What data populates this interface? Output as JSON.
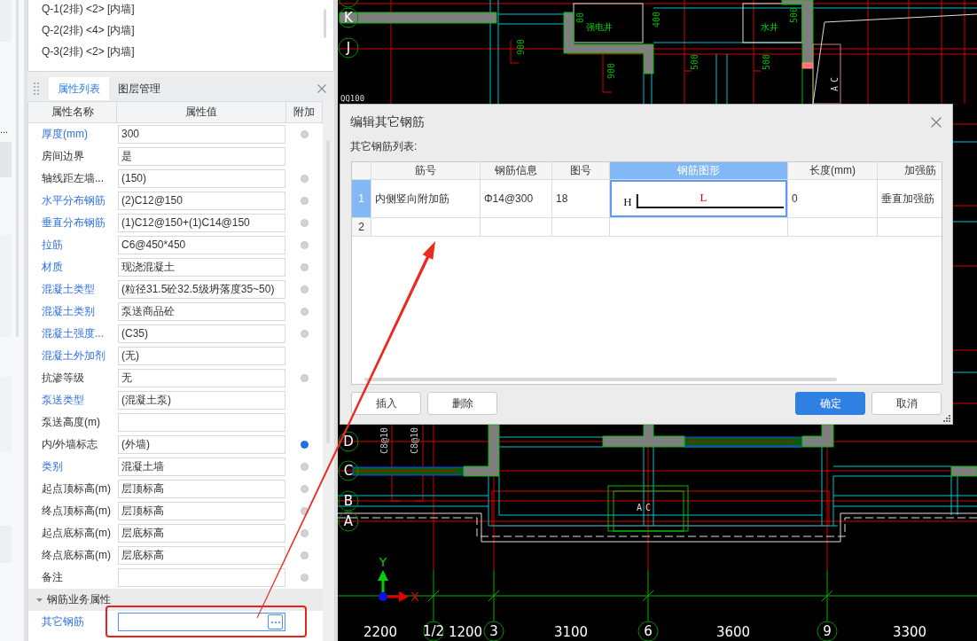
{
  "left_strip": {
    "label": "..."
  },
  "component_list": {
    "items": [
      {
        "label": "Q-1(2排) <2> [内墙]",
        "selected": false
      },
      {
        "label": "Q-2(2排) <4> [内墙]",
        "selected": false
      },
      {
        "label": "Q-3(2排) <2> [内墙]",
        "selected": false
      }
    ]
  },
  "properties_panel": {
    "tabs": [
      {
        "label": "属性列表",
        "selected": true
      },
      {
        "label": "图层管理",
        "selected": false
      }
    ],
    "columns": [
      "属性名称",
      "属性值",
      "附加"
    ],
    "rows": [
      {
        "kind": "property",
        "label": "厚度(mm)",
        "public": true,
        "value": "300",
        "focused": false,
        "checked": false
      },
      {
        "kind": "property",
        "label": "房间边界",
        "public": false,
        "value": "是",
        "focused": false
      },
      {
        "kind": "property",
        "label": "轴线距左墙...",
        "public": false,
        "value": "(150)",
        "focused": false,
        "checked": false
      },
      {
        "kind": "property",
        "label": "水平分布钢筋",
        "public": true,
        "value": "(2)C12@150",
        "focused": false,
        "checked": false
      },
      {
        "kind": "property",
        "label": "垂直分布钢筋",
        "public": true,
        "value": "(1)C12@150+(1)C14@150",
        "focused": false,
        "checked": false
      },
      {
        "kind": "property",
        "label": "拉筋",
        "public": true,
        "value": "C6@450*450",
        "focused": false,
        "checked": false
      },
      {
        "kind": "property",
        "label": "材质",
        "public": true,
        "value": "现浇混凝土",
        "focused": false,
        "checked": false
      },
      {
        "kind": "property",
        "label": "混凝土类型",
        "public": true,
        "value": "(粒径31.5砼32.5级坍落度35~50)",
        "focused": false,
        "checked": false
      },
      {
        "kind": "property",
        "label": "混凝土类别",
        "public": true,
        "value": "泵送商品砼",
        "focused": false,
        "checked": false
      },
      {
        "kind": "property",
        "label": "混凝土强度...",
        "public": true,
        "value": "(C35)",
        "focused": false,
        "checked": false
      },
      {
        "kind": "property",
        "label": "混凝土外加剂",
        "public": true,
        "value": "(无)",
        "focused": false
      },
      {
        "kind": "property",
        "label": "抗渗等级",
        "public": false,
        "value": "无",
        "focused": false,
        "checked": false
      },
      {
        "kind": "property",
        "label": "泵送类型",
        "public": true,
        "value": "(混凝土泵)",
        "focused": false
      },
      {
        "kind": "property",
        "label": "泵送高度(m)",
        "public": false,
        "focused": false
      },
      {
        "kind": "property",
        "label": "内/外墙标志",
        "public": false,
        "value": "(外墙)",
        "focused": false,
        "checked": true
      },
      {
        "kind": "property",
        "label": "类别",
        "public": true,
        "value": "混凝土墙",
        "focused": false,
        "checked": false
      },
      {
        "kind": "property",
        "label": "起点顶标高(m)",
        "public": false,
        "value": "层顶标高",
        "focused": false,
        "checked": false
      },
      {
        "kind": "property",
        "label": "终点顶标高(m)",
        "public": false,
        "value": "层顶标高",
        "focused": false,
        "checked": false
      },
      {
        "kind": "property",
        "label": "起点底标高(m)",
        "public": false,
        "value": "层底标高",
        "focused": false,
        "checked": false
      },
      {
        "kind": "property",
        "label": "终点底标高(m)",
        "public": false,
        "value": "层底标高",
        "focused": false,
        "checked": false
      },
      {
        "kind": "property",
        "label": "备注",
        "public": false,
        "focused": false,
        "checked": false
      },
      {
        "kind": "group",
        "title": "钢筋业务属性",
        "expanded": true
      },
      {
        "kind": "property",
        "label": "其它钢筋",
        "public": true,
        "focused": true
      }
    ]
  },
  "drawing": {
    "row_axes": [
      "K",
      "J",
      "D",
      "C",
      "B",
      "A"
    ],
    "column_axes": [
      "1/2",
      "3",
      "6",
      "9"
    ],
    "spans": [
      "2200",
      "1200",
      "3100",
      "3600",
      "3300"
    ],
    "dimension_marks": [
      "900",
      "00",
      "900",
      "400",
      "500",
      "500",
      "500"
    ],
    "room_labels": [
      "强电井",
      "水井"
    ],
    "rebar_notes": [
      "C8@10",
      "C8@10"
    ],
    "unit_labels": [
      "AC",
      "AC"
    ],
    "wall_tag": "QQ100",
    "axes": {
      "x": "X",
      "y": "Y"
    }
  },
  "dialog": {
    "title": "编辑其它钢筋",
    "list_label": "其它钢筋列表:",
    "columns": [
      {
        "label": "筋号",
        "selected": false
      },
      {
        "label": "钢筋信息",
        "selected": false
      },
      {
        "label": "图号",
        "selected": false
      },
      {
        "label": "钢筋图形",
        "selected": true
      },
      {
        "label": "长度(mm)",
        "selected": false
      },
      {
        "label": "加强筋",
        "selected": false
      }
    ],
    "rows": [
      {
        "number": "1",
        "selected": true,
        "name": "内侧竖向附加筋",
        "rebar_info": "Φ14@300",
        "figure_no": "18",
        "shape": {
          "side_label": "H",
          "length_label": "L"
        },
        "length": "0",
        "column_6": "垂直加强筋"
      },
      {
        "number": "2",
        "selected": false
      }
    ],
    "left_buttons": [
      {
        "label": "插入",
        "primary": false
      },
      {
        "label": "删除",
        "primary": false
      }
    ],
    "right_buttons": [
      {
        "label": "确定",
        "primary": true
      },
      {
        "label": "取消",
        "primary": false
      }
    ]
  }
}
